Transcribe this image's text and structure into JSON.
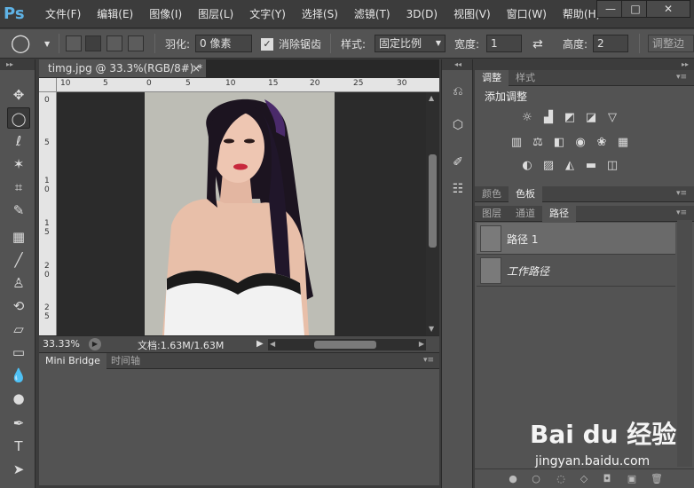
{
  "app": {
    "logo": "Ps"
  },
  "menu": [
    "文件(F)",
    "编辑(E)",
    "图像(I)",
    "图层(L)",
    "文字(Y)",
    "选择(S)",
    "滤镜(T)",
    "3D(D)",
    "视图(V)",
    "窗口(W)",
    "帮助(H)"
  ],
  "window_controls": {
    "minimize": "—",
    "maximize": "□",
    "close": "✕"
  },
  "options": {
    "feather_label": "羽化:",
    "feather_value": "0 像素",
    "antialias_label": "消除锯齿",
    "antialias_checked": true,
    "style_label": "样式:",
    "style_value": "固定比例",
    "width_label": "宽度:",
    "width_value": "1",
    "height_label": "高度:",
    "height_value": "2",
    "refine_button": "调整边"
  },
  "document": {
    "tab_title": "timg.jpg @ 33.3%(RGB/8#) *",
    "tab_close": "×",
    "ruler_h": [
      "10",
      "5",
      "0",
      "5",
      "10",
      "15",
      "20",
      "25",
      "30"
    ],
    "ruler_v": [
      "0",
      "5",
      "1\n0",
      "1\n5",
      "2\n0",
      "2\n5"
    ],
    "zoom": "33.33%",
    "doc_info": "文档:1.63M/1.63M"
  },
  "bottom_panel": {
    "tabs": [
      "Mini Bridge",
      "时间轴"
    ],
    "active": 0
  },
  "adjustments": {
    "tabs": [
      "调整",
      "样式"
    ],
    "title": "添加调整",
    "icons_row1": [
      "brightness-icon",
      "levels-icon",
      "curves-icon",
      "exposure-icon",
      "vibrance-icon"
    ],
    "icons_row2": [
      "hue-saturation-icon",
      "color-balance-icon",
      "black-white-icon",
      "photo-filter-icon",
      "channel-mixer-icon",
      "color-lookup-icon"
    ],
    "icons_row3": [
      "invert-icon",
      "posterize-icon",
      "threshold-icon",
      "gradient-map-icon",
      "selective-color-icon"
    ]
  },
  "color_panel": {
    "tabs": [
      "颜色",
      "色板"
    ],
    "active": 1
  },
  "paths_panel": {
    "tabs": [
      "图层",
      "通道",
      "路径"
    ],
    "active": 2,
    "rows": [
      {
        "name": "路径 1",
        "italic": false,
        "selected": true
      },
      {
        "name": "工作路径",
        "italic": true,
        "selected": false
      }
    ]
  },
  "watermark": {
    "brand": "Bai du 经验",
    "url": "jingyan.baidu.com"
  }
}
